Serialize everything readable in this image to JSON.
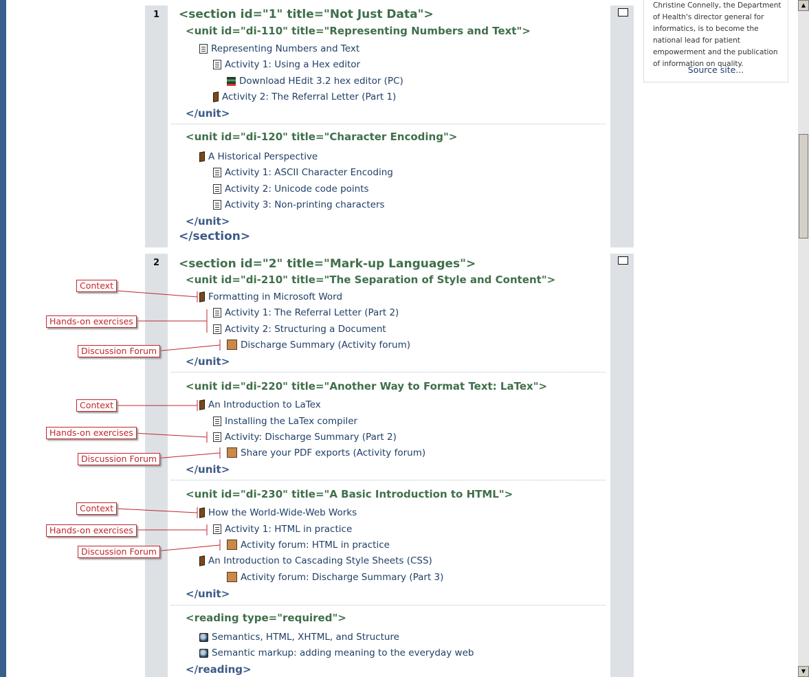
{
  "sidebar": {
    "text": "Christine Connelly, the Department of Health's director general for informatics, is to become the national lead for patient empowerment and the publication of information on quality.",
    "source_link": "Source site..."
  },
  "section1": {
    "number": "1",
    "open_tag": "<section id=\"1\" title=\"Not Just Data\">",
    "unit1": {
      "open_tag": "<unit id=\"di-110\" title=\"Representing Numbers and Text\">",
      "items": [
        "Representing Numbers and Text",
        "Activity 1: Using a Hex editor",
        "Download HEdit 3.2 hex editor (PC)",
        "Activity 2: The Referral Letter (Part 1)"
      ],
      "close_tag": "</unit>"
    },
    "unit2": {
      "open_tag": "<unit id=\"di-120\" title=\"Character Encoding\">",
      "items": [
        "A Historical Perspective",
        "Activity 1: ASCII Character Encoding",
        "Activity 2: Unicode code points",
        "Activity 3: Non-printing characters"
      ],
      "close_tag": "</unit>"
    },
    "close_tag": "</section>"
  },
  "section2": {
    "number": "2",
    "open_tag": "<section id=\"2\" title=\"Mark-up Languages\">",
    "unit1": {
      "open_tag": "<unit id=\"di-210\" title=\"The Separation of Style and Content\">",
      "items": [
        "Formatting in Microsoft Word",
        "Activity 1: The Referral Letter (Part 2)",
        "Activity 2: Structuring a Document",
        "Discharge Summary (Activity forum)"
      ],
      "close_tag": "</unit>"
    },
    "unit2": {
      "open_tag": "<unit id=\"di-220\" title=\"Another Way to Format Text: LaTex\">",
      "items": [
        "An Introduction to LaTex",
        "Installing the LaTex compiler",
        "Activity: Discharge Summary (Part 2)",
        "Share your PDF exports (Activity forum)"
      ],
      "close_tag": "</unit>"
    },
    "unit3": {
      "open_tag": "<unit id=\"di-230\" title=\"A Basic Introduction to HTML\">",
      "items": [
        "How the World-Wide-Web Works",
        "Activity 1: HTML in practice",
        "Activity forum: HTML in practice",
        "An Introduction to Cascading Style Sheets (CSS)",
        "Activity forum: Discharge Summary (Part 3)"
      ],
      "close_tag": "</unit>"
    },
    "reading": {
      "open_tag": "<reading type=\"required\">",
      "items": [
        "Semantics, HTML, XHTML, and Structure",
        "Semantic markup: adding meaning to the everyday web"
      ],
      "close_tag": "</reading>"
    }
  },
  "annotations": {
    "context": "Context",
    "hands_on": "Hands-on exercises",
    "forum": "Discussion Forum"
  }
}
